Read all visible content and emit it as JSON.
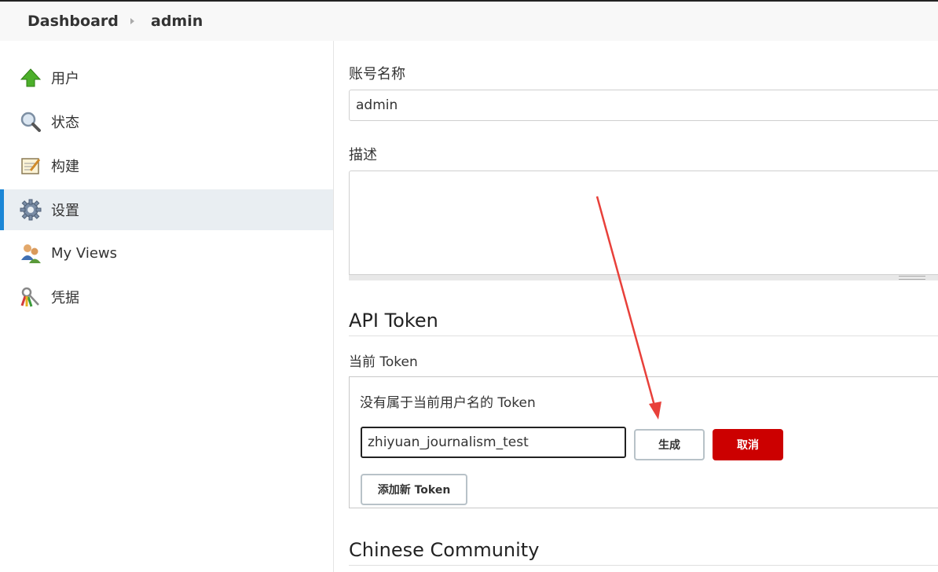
{
  "breadcrumb": {
    "dashboard": "Dashboard",
    "user": "admin"
  },
  "sidebar": {
    "items": [
      {
        "label": "用户",
        "icon": "up-arrow-icon"
      },
      {
        "label": "状态",
        "icon": "magnifier-icon"
      },
      {
        "label": "构建",
        "icon": "notepad-icon"
      },
      {
        "label": "设置",
        "icon": "gear-icon",
        "active": true
      },
      {
        "label": "My Views",
        "icon": "users-icon"
      },
      {
        "label": "凭据",
        "icon": "keys-icon"
      }
    ]
  },
  "form": {
    "account_label": "账号名称",
    "account_value": "admin",
    "description_label": "描述",
    "description_value": ""
  },
  "api_token": {
    "heading": "API Token",
    "current_label": "当前 Token",
    "empty_note": "没有属于当前用户名的 Token",
    "name_value": "zhiyuan_journalism_test",
    "generate_label": "生成",
    "cancel_label": "取消",
    "add_label": "添加新 Token"
  },
  "community": {
    "heading": "Chinese Community"
  },
  "colors": {
    "accent": "#1b86d6",
    "cancel": "#cc0000",
    "annotation_arrow": "#e8403a"
  }
}
